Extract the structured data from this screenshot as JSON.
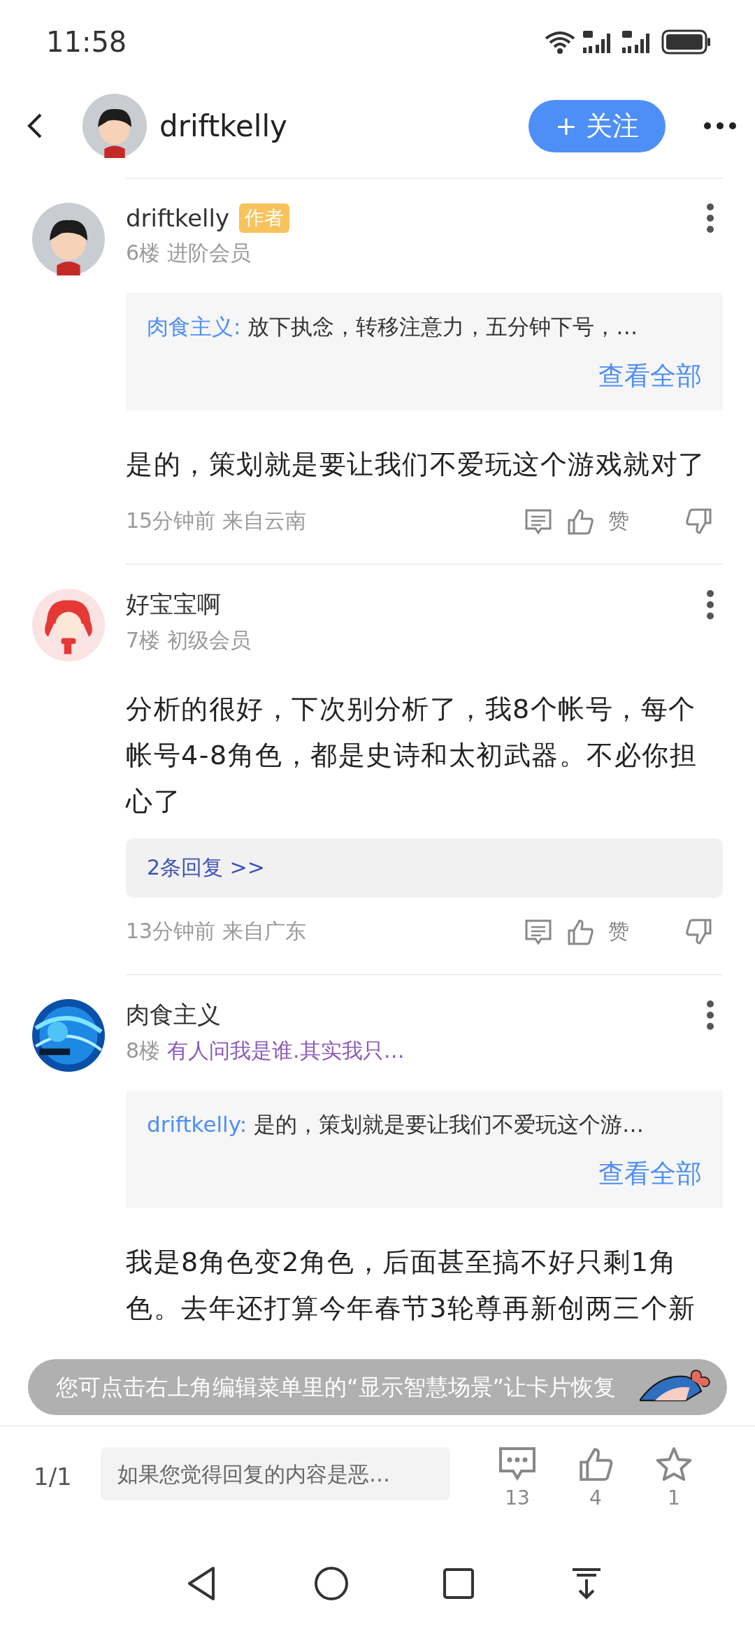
{
  "status_bar": {
    "time": "11:58"
  },
  "header": {
    "username": "driftkelly",
    "follow_button": "+ 关注"
  },
  "posts": [
    {
      "avatar": {
        "kind": "boy"
      },
      "name": "driftkelly",
      "author": true,
      "author_badge": "作者",
      "floor": "6楼",
      "tag": {
        "text": "进阶会员",
        "kind": "rank"
      },
      "quote": {
        "author": "肉食主义:",
        "text": "放下执念，转移注意力，五分钟下号，…",
        "link": "查看全部"
      },
      "content": "是的，策划就是要让我们不爱玩这个游戏就对了",
      "time": "15分钟前",
      "location": "来自云南",
      "like_label": "赞"
    },
    {
      "avatar": {
        "kind": "girl"
      },
      "name": "好宝宝啊",
      "author": false,
      "floor": "7楼",
      "tag": {
        "text": "初级会员",
        "kind": "rank"
      },
      "content": "分析的很好，下次别分析了，我8个帐号，每个帐号4-8角色，都是史诗和太初武器。不必你担心了",
      "replies": "2条回复 >>",
      "time": "13分钟前",
      "location": "来自广东",
      "like_label": "赞"
    },
    {
      "name": "肉食主义",
      "author": false,
      "floor": "8楼",
      "tag": {
        "text": "有人问我是谁.其实我只…",
        "kind": "title"
      },
      "quote": {
        "author": "driftkelly:",
        "text": "是的，策划就是要让我们不爱玩这个游…",
        "link": "查看全部"
      },
      "content": "我是8角色变2角色，后面甚至搞不好只剩1角色。去年还打算今年春节3轮尊再新创两三个新"
    }
  ],
  "bottom_bar": {
    "page": "1/1",
    "placeholder": "如果您觉得回复的内容是恶…",
    "comments": "13",
    "likes": "4",
    "favorites": "1"
  },
  "toast": {
    "text": "您可点击右上角编辑菜单里的“显示智慧场景”让卡片恢复"
  }
}
